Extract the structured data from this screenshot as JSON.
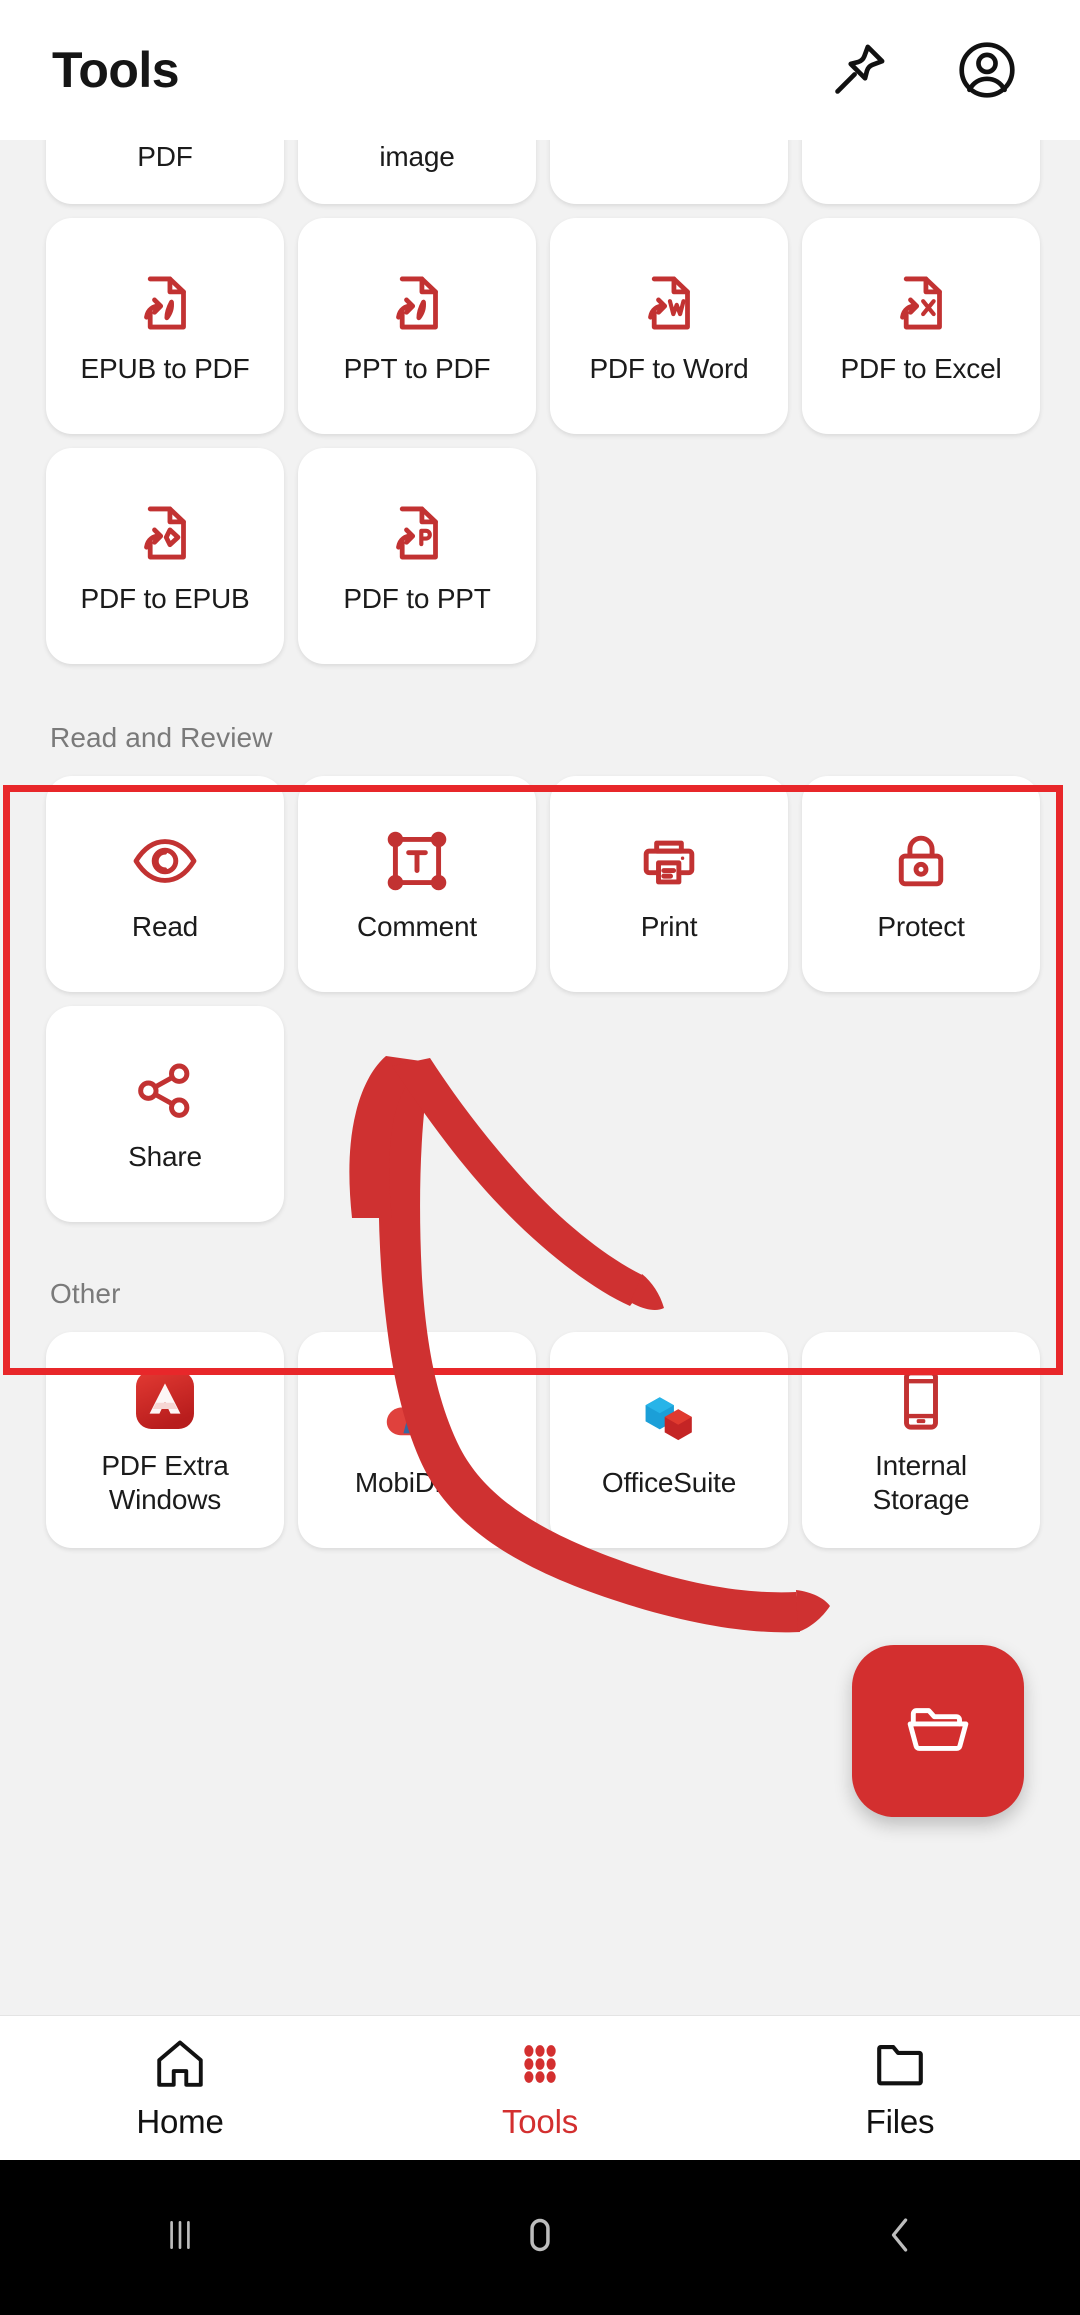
{
  "header": {
    "title": "Tools",
    "pin_icon": "pin-icon",
    "account_icon": "account-circle-icon"
  },
  "convert_section": {
    "partial_row": [
      {
        "label": "PDF",
        "icon": "pdf-convert-icon",
        "cut_off": true
      },
      {
        "label": "image",
        "icon": "image-convert-icon",
        "cut_off": true
      },
      {
        "label": "",
        "icon": "blank-icon",
        "cut_off": true
      },
      {
        "label": "",
        "icon": "blank-icon",
        "cut_off": true
      }
    ],
    "row2": [
      {
        "label": "EPUB to PDF",
        "icon": "epub-to-pdf-icon"
      },
      {
        "label": "PPT to PDF",
        "icon": "ppt-to-pdf-icon"
      },
      {
        "label": "PDF to Word",
        "icon": "pdf-to-word-icon"
      },
      {
        "label": "PDF to Excel",
        "icon": "pdf-to-excel-icon"
      }
    ],
    "row3": [
      {
        "label": "PDF to EPUB",
        "icon": "pdf-to-epub-icon"
      },
      {
        "label": "PDF to PPT",
        "icon": "pdf-to-ppt-icon"
      }
    ]
  },
  "read_review_section": {
    "title": "Read and Review",
    "items": [
      {
        "label": "Read",
        "icon": "eye-icon"
      },
      {
        "label": "Comment",
        "icon": "text-comment-icon"
      },
      {
        "label": "Print",
        "icon": "printer-icon"
      },
      {
        "label": "Protect",
        "icon": "lock-icon"
      },
      {
        "label": "Share",
        "icon": "share-nodes-icon"
      }
    ]
  },
  "other_section": {
    "title": "Other",
    "items": [
      {
        "label": "PDF Extra\nWindows",
        "label_line1": "PDF Extra",
        "label_line2": "Windows",
        "icon": "pdf-extra-windows-logo"
      },
      {
        "label": "MobiDrive",
        "label_line1": "MobiDrive",
        "label_line2": "",
        "icon": "mobidrive-logo"
      },
      {
        "label": "OfficeSuite",
        "label_line1": "OfficeSuite",
        "label_line2": "",
        "icon": "officesuite-logo"
      },
      {
        "label": "Internal\nStorage",
        "label_line1": "Internal",
        "label_line2": "Storage",
        "icon": "phone-storage-icon"
      }
    ]
  },
  "fab": {
    "icon": "open-folder-icon",
    "label": "Open file"
  },
  "bottom_nav": {
    "items": [
      {
        "label": "Home",
        "icon": "home-icon",
        "active": false
      },
      {
        "label": "Tools",
        "icon": "grid-dots-icon",
        "active": true
      },
      {
        "label": "Files",
        "icon": "folder-icon",
        "active": false
      }
    ]
  },
  "system_nav": {
    "recents_icon": "recents-icon",
    "home_icon": "home-pill-icon",
    "back_icon": "back-chevron-icon"
  },
  "annotations": {
    "highlight_box": "red-highlight-rectangle",
    "arrow": "red-handdrawn-arrow"
  },
  "colors": {
    "brand_red": "#d32f2f",
    "annotation_red": "#e8272a",
    "icon_red": "#c23232",
    "page_bg": "#f2f2f2",
    "card_bg": "#ffffff",
    "section_label": "#7a7a7a",
    "text": "#1b1b1b"
  }
}
